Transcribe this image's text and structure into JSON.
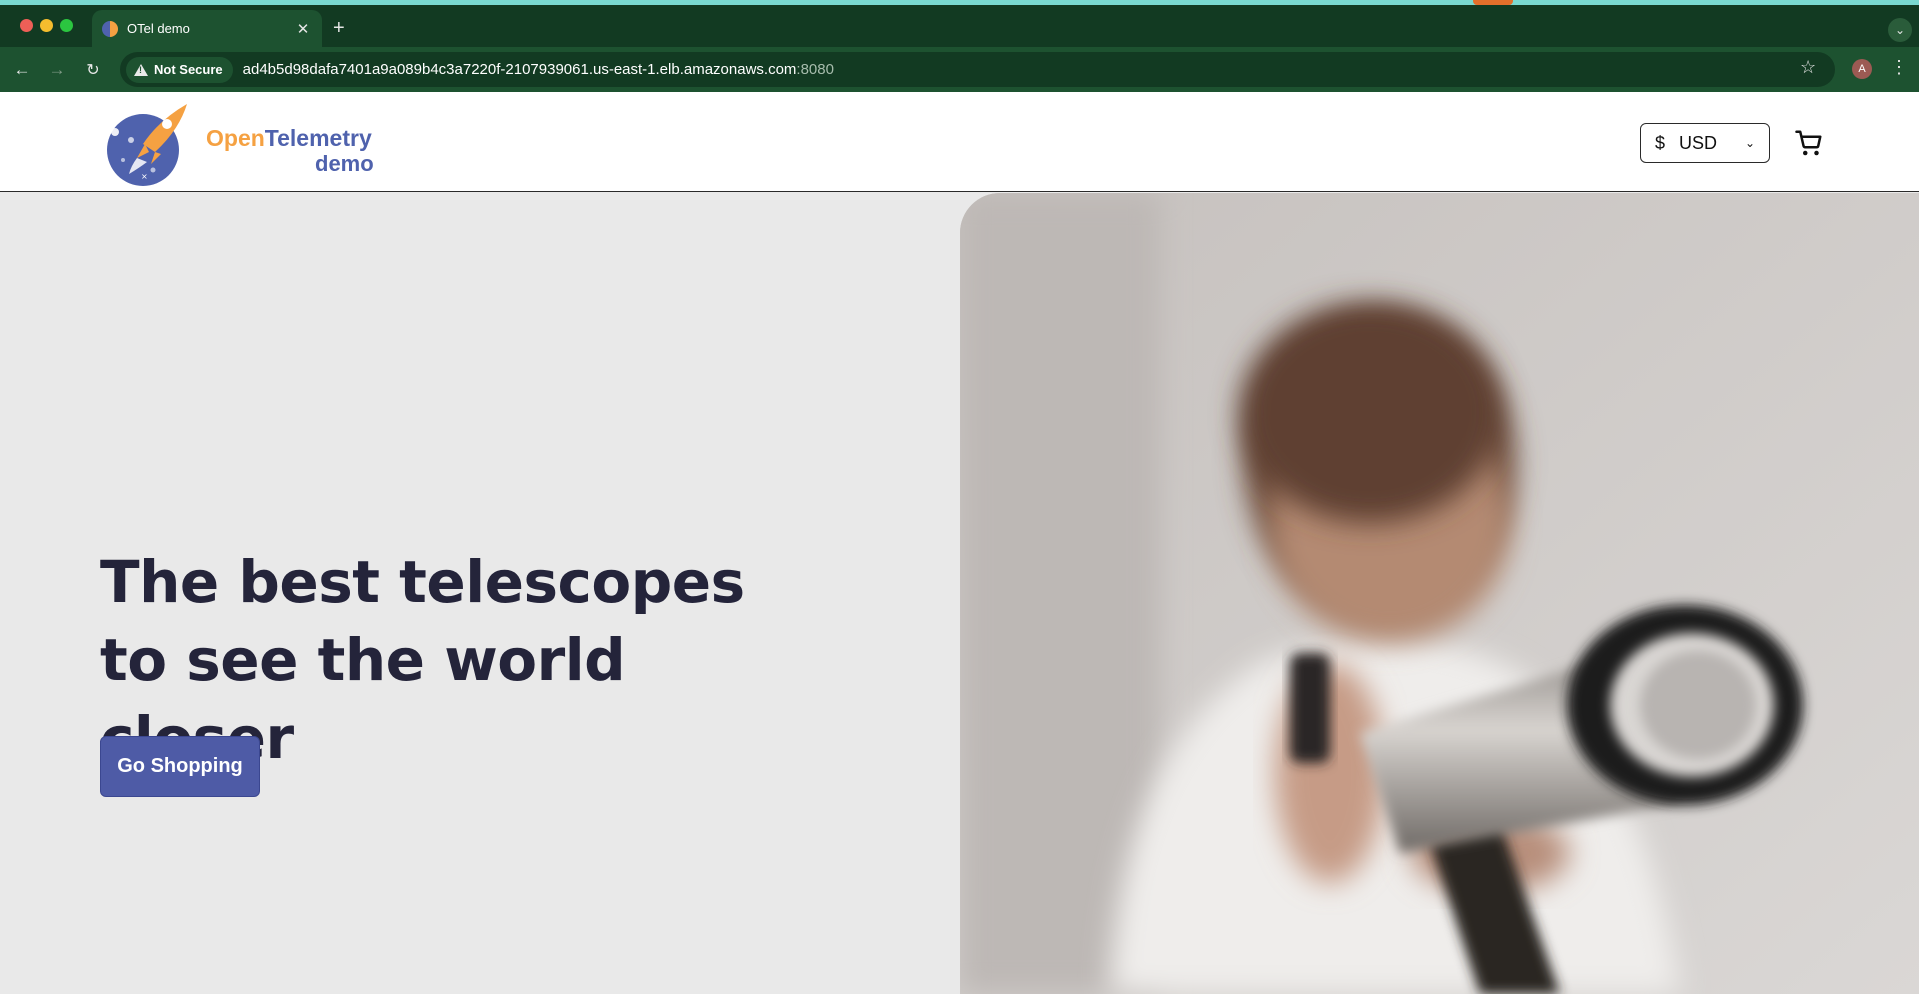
{
  "browser": {
    "tab_title": "OTel demo",
    "tab_close": "✕",
    "new_tab": "+",
    "tab_menu": "⌄",
    "nav": {
      "back": "←",
      "forward": "→",
      "reload": "↻"
    },
    "security_label": "Not Secure",
    "url_host": "ad4b5d98dafa7401a9a089b4c3a7220f-2107939061.us-east-1.elb.amazonaws.com",
    "url_port": ":8080",
    "star": "☆",
    "profile_initial": "A",
    "menu": "⋮"
  },
  "header": {
    "logo_open": "Open",
    "logo_telemetry": "Telemetry",
    "logo_demo": "demo",
    "currency_symbol": "$",
    "currency_code": "USD",
    "currency_chevron": "⌄"
  },
  "hero": {
    "title": "The best telescopes to see the world closer",
    "cta_label": "Go Shopping"
  },
  "colors": {
    "chrome_dark": "#123a22",
    "chrome_mid": "#1d5230",
    "brand_orange": "#f5a142",
    "brand_blue": "#4f62ad",
    "cta": "#4e5ba6",
    "hero_text": "#24243a",
    "hero_bg": "#e9e9e9"
  }
}
